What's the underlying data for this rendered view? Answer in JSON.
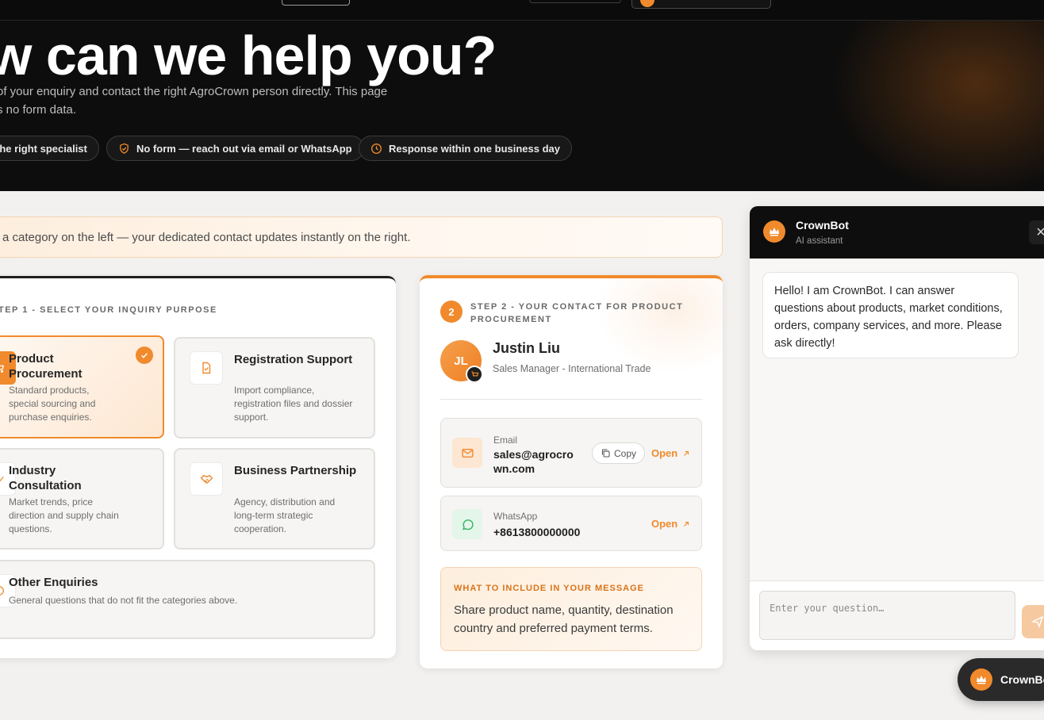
{
  "hero": {
    "title": "w can we help you?",
    "subtitle": "of your enquiry and contact the right AgroCrown person directly. This page s no form data.",
    "pills": [
      {
        "label": "the right specialist",
        "icon": "none"
      },
      {
        "label": "No form — reach out via email or WhatsApp",
        "icon": "shield-check-icon"
      },
      {
        "label": "Response within one business day",
        "icon": "clock-icon"
      }
    ]
  },
  "banner": {
    "text": "a category on the left — your dedicated contact updates instantly on the right."
  },
  "step1": {
    "heading": "TEP 1 - SELECT YOUR INQUIRY PURPOSE",
    "options": [
      {
        "title": "Product Procurement",
        "desc": "Standard products, special sourcing and purchase enquiries.",
        "selected": true,
        "icon": "cart-icon"
      },
      {
        "title": "Registration Support",
        "desc": "Import compliance, registration files and dossier support.",
        "selected": false,
        "icon": "document-check-icon"
      },
      {
        "title": "Industry Consultation",
        "desc": "Market trends, price direction and supply chain questions.",
        "selected": false,
        "icon": "chart-icon"
      },
      {
        "title": "Business Partnership",
        "desc": "Agency, distribution and long-term strategic cooperation.",
        "selected": false,
        "icon": "handshake-icon"
      },
      {
        "title": "Other Enquiries",
        "desc": "General questions that do not fit the categories above.",
        "selected": false,
        "icon": "help-circle-icon"
      }
    ]
  },
  "step2": {
    "number": "2",
    "heading": "STEP 2 - YOUR CONTACT FOR PRODUCT PROCUREMENT",
    "contact": {
      "initials": "JL",
      "name": "Justin Liu",
      "role": "Sales Manager - International Trade"
    },
    "email": {
      "label": "Email",
      "value": "sales@agrocrown.com",
      "copy_label": "Copy",
      "open_label": "Open"
    },
    "whatsapp": {
      "label": "WhatsApp",
      "value": "+8613800000000",
      "open_label": "Open"
    },
    "tip": {
      "heading": "WHAT TO INCLUDE IN YOUR MESSAGE",
      "text": "Share product name, quantity, destination country and preferred payment terms."
    }
  },
  "chat": {
    "name": "CrownBot",
    "subtitle": "AI assistant",
    "close_icon": "×",
    "message": "Hello! I am CrownBot. I can answer questions about products, market conditions, orders, company services, and more. Please ask directly!",
    "placeholder": "Enter your question…"
  },
  "fab": {
    "label": "CrownBot"
  },
  "colors": {
    "accent": "#f08a2c",
    "dark": "#0d0d0d",
    "background": "#f3f1ef"
  }
}
